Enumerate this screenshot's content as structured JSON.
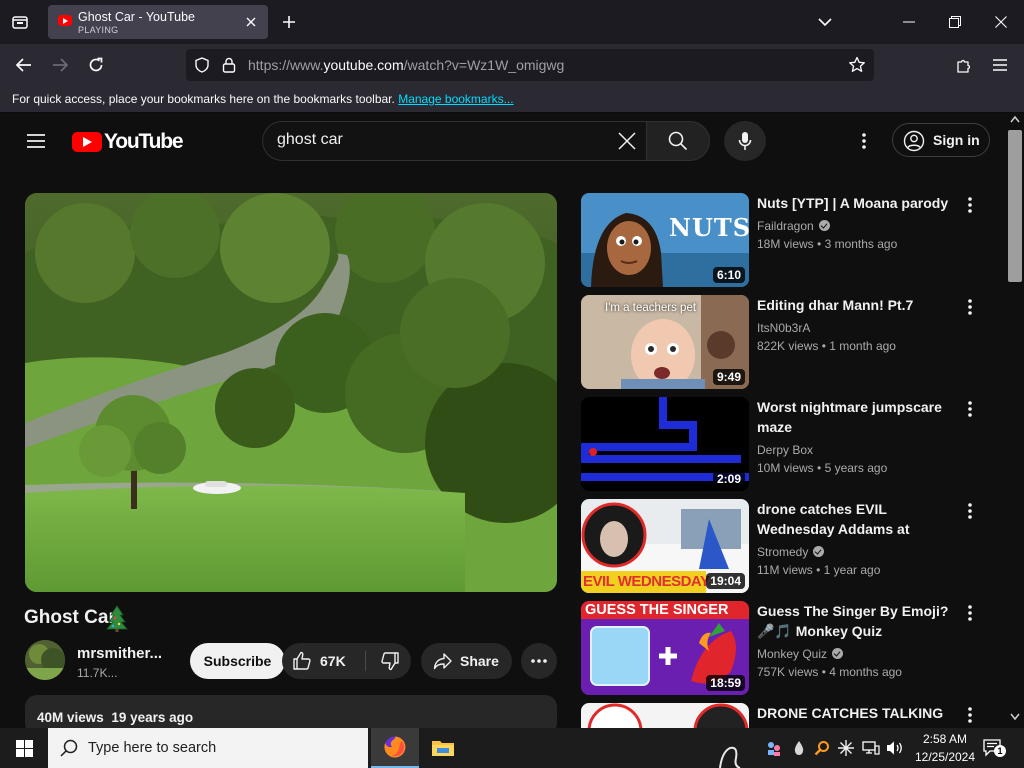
{
  "browser": {
    "tab": {
      "title": "Ghost Car - YouTube",
      "status": "PLAYING"
    },
    "url": {
      "prefix": "https://www.",
      "domain": "youtube.com",
      "path": "/watch?v=Wz1W_omigwg"
    },
    "bookmarks": {
      "text": "For quick access, place your bookmarks here on the bookmarks toolbar.",
      "link": "Manage bookmarks..."
    }
  },
  "youtube": {
    "logo_text": "YouTube",
    "search": {
      "value": "ghost car"
    },
    "sign_in": "Sign in",
    "video": {
      "title": "Ghost Car",
      "channel": "mrsmither...",
      "subscribers": "11.7K...",
      "subscribe": "Subscribe",
      "likes": "67K",
      "share": "Share",
      "views": "40M views",
      "age": "19 years ago"
    },
    "recommendations": [
      {
        "title": "Nuts [YTP] | A Moana parody",
        "channel": "Faildragon",
        "verified": true,
        "views": "18M views",
        "age": "3 months ago",
        "duration": "6:10",
        "thumb_text": "NUTS"
      },
      {
        "title": "Editing dhar Mann! Pt.7",
        "channel": "ItsN0b3rA",
        "verified": false,
        "views": "822K views",
        "age": "1 month ago",
        "duration": "9:49",
        "thumb_text": "I'm a teachers pet"
      },
      {
        "title": "Worst nightmare jumpscare maze",
        "channel": "Derpy Box",
        "verified": false,
        "views": "10M views",
        "age": "5 years ago",
        "duration": "2:09",
        "thumb_text": ""
      },
      {
        "title": "drone catches EVIL Wednesday Addams at haunted park (we...",
        "channel": "Stromedy",
        "verified": true,
        "views": "11M views",
        "age": "1 year ago",
        "duration": "19:04",
        "thumb_text": "EVIL WEDNESDAY"
      },
      {
        "title": "Guess The Singer By Emoji? 🎤🎵 Monkey Quiz",
        "channel": "Monkey Quiz",
        "verified": true,
        "views": "757K views",
        "age": "4 months ago",
        "duration": "18:59",
        "thumb_text": "GUESS THE SINGER"
      },
      {
        "title": "DRONE CATCHES TALKING",
        "channel": "",
        "verified": false,
        "views": "",
        "age": "",
        "duration": "",
        "thumb_text": ""
      }
    ]
  },
  "taskbar": {
    "search_placeholder": "Type here to search",
    "time": "2:58 AM",
    "date": "12/25/2024",
    "notifications": "1"
  },
  "colors": {
    "youtube_red": "#ff0000",
    "link_cyan": "#00ddff",
    "page_bg": "#0f0f0f"
  }
}
